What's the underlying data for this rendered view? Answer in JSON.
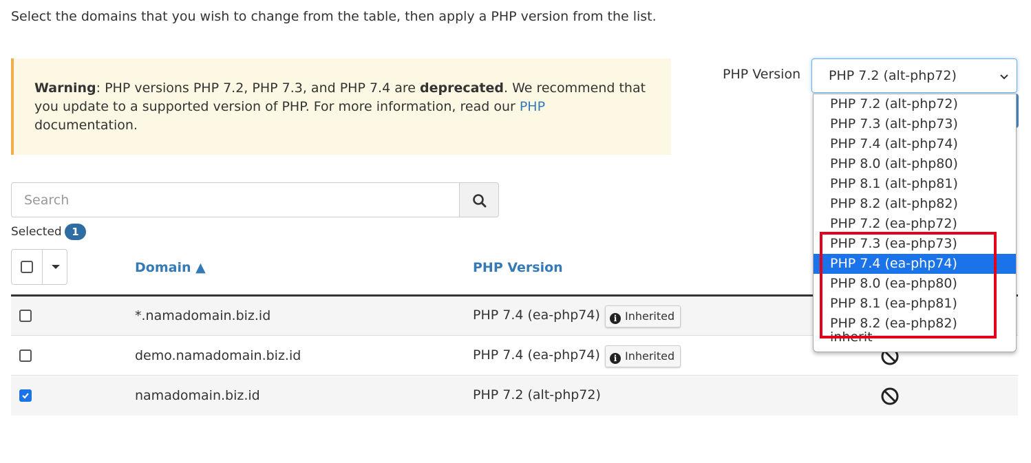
{
  "intro_text": "Select the domains that you wish to change from the table, then apply a PHP version from the list.",
  "warning": {
    "label": "Warning",
    "text1": ": PHP versions PHP 7.2, PHP 7.3, and PHP 7.4 are ",
    "bold": "deprecated",
    "text2": ". We recommend that you update to a supported version of PHP. For more information, read our ",
    "link": "PHP",
    "text3": " documentation."
  },
  "php_version_select": {
    "label": "PHP Version",
    "selected": "PHP 7.2 (alt-php72)",
    "options": [
      "PHP 7.2 (alt-php72)",
      "PHP 7.3 (alt-php73)",
      "PHP 7.4 (alt-php74)",
      "PHP 8.0 (alt-php80)",
      "PHP 8.1 (alt-php81)",
      "PHP 8.2 (alt-php82)",
      "PHP 7.2 (ea-php72)",
      "PHP 7.3 (ea-php73)",
      "PHP 7.4 (ea-php74)",
      "PHP 8.0 (ea-php80)",
      "PHP 8.1 (ea-php81)",
      "PHP 8.2 (ea-php82)",
      "inherit"
    ],
    "highlighted_option": "PHP 7.4 (ea-php74)"
  },
  "search": {
    "placeholder": "Search"
  },
  "selected": {
    "label": "Selected",
    "count": "1"
  },
  "table": {
    "headers": {
      "domain": "Domain ▲",
      "php_version": "PHP Version"
    },
    "rows": [
      {
        "domain": "*.namadomain.biz.id",
        "php": "PHP 7.4 (ea-php74)",
        "badge": "Inherited",
        "checked": false
      },
      {
        "domain": "demo.namadomain.biz.id",
        "php": "PHP 7.4 (ea-php74)",
        "badge": "Inherited",
        "checked": false
      },
      {
        "domain": "namadomain.biz.id",
        "php": "PHP 7.2 (alt-php72)",
        "badge": "",
        "checked": true
      }
    ]
  },
  "colors": {
    "link": "#337ab7",
    "warning_bg": "#fcf8e3",
    "selected_option": "#1a73e8",
    "highlight_box": "#e3001b",
    "badge": "#2e6da4"
  },
  "icons": [
    "search-icon",
    "chevron-down-icon",
    "caret-down-icon",
    "info-icon",
    "ban-icon",
    "checkmark-icon"
  ]
}
